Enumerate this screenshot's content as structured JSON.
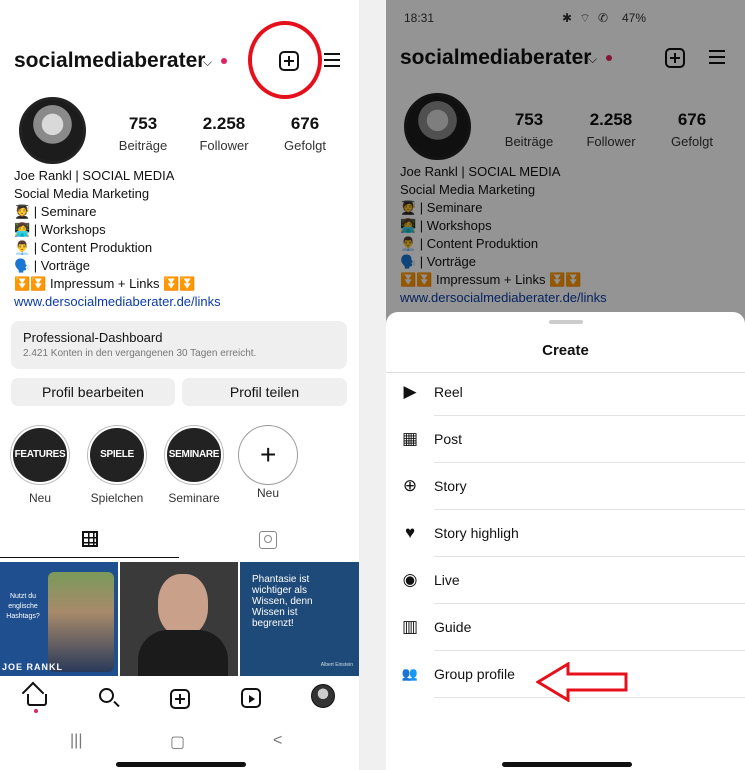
{
  "left": {
    "username": "socialmediaberater",
    "stats": [
      {
        "num": "753",
        "label": "Beiträge"
      },
      {
        "num": "2.258",
        "label": "Follower"
      },
      {
        "num": "676",
        "label": "Gefolgt"
      }
    ],
    "bio": [
      "Joe Rankl | SOCIAL MEDIA",
      "Social Media Marketing",
      "🧑‍🎓 | Seminare",
      "👩‍💻 | Workshops",
      "👨‍💼 | Content Produktion",
      "🗣️ | Vorträge",
      "⏬⏬ Impressum + Links ⏬⏬"
    ],
    "link": "www.dersocialmediaberater.de/links",
    "dashboard": {
      "title": "Professional-Dashboard",
      "subtitle": "2.421 Konten in den vergangenen 30 Tagen erreicht."
    },
    "buttons": {
      "edit": "Profil bearbeiten",
      "share": "Profil teilen"
    },
    "highlights": [
      {
        "cover": "FEATURES",
        "name": "Neu"
      },
      {
        "cover": "SPIELE",
        "name": "Spielchen"
      },
      {
        "cover": "SEMINARE",
        "name": "Seminare"
      },
      {
        "cover": "+",
        "name": "Neu"
      }
    ],
    "posts": {
      "p1_text": "Nutzt du englische Hashtags?",
      "p1_brand": "JOE RANKL",
      "p3_quote": "Phantasie ist wichtiger als Wissen, denn Wissen ist begrenzt!",
      "p3_author": "Albert Einstein"
    },
    "sysnav": {
      "recent": "|||",
      "home": "▢",
      "back": "<"
    }
  },
  "right": {
    "status": {
      "time": "18:31",
      "battery": "47%"
    },
    "username": "socialmediaberater",
    "stats": [
      {
        "num": "753",
        "label": "Beiträge"
      },
      {
        "num": "2.258",
        "label": "Follower"
      },
      {
        "num": "676",
        "label": "Gefolgt"
      }
    ],
    "bio": [
      "Joe Rankl | SOCIAL MEDIA",
      "Social Media Marketing",
      "🧑‍🎓 | Seminare",
      "👩‍💻 | Workshops",
      "👨‍💼 | Content Produktion",
      "🗣️ | Vorträge",
      "⏬⏬ Impressum + Links ⏬⏬"
    ],
    "link": "www.dersocialmediaberater.de/links",
    "sheet": {
      "title": "Create",
      "items": [
        {
          "label": "Reel",
          "icon": "reel-icon",
          "glyph": "▶"
        },
        {
          "label": "Post",
          "icon": "grid-icon",
          "glyph": "▦"
        },
        {
          "label": "Story",
          "icon": "story-add-icon",
          "glyph": "⊕"
        },
        {
          "label": "Story highligh",
          "icon": "heart-circle-icon",
          "glyph": "♥"
        },
        {
          "label": "Live",
          "icon": "live-icon",
          "glyph": "◉"
        },
        {
          "label": "Guide",
          "icon": "book-icon",
          "glyph": "▥"
        },
        {
          "label": "Group profile",
          "icon": "group-icon",
          "glyph": "👥"
        }
      ]
    }
  },
  "colors": {
    "annotation_red": "#e5101b",
    "link_blue": "#0b3ba6",
    "notification_red": "#e0245e"
  }
}
